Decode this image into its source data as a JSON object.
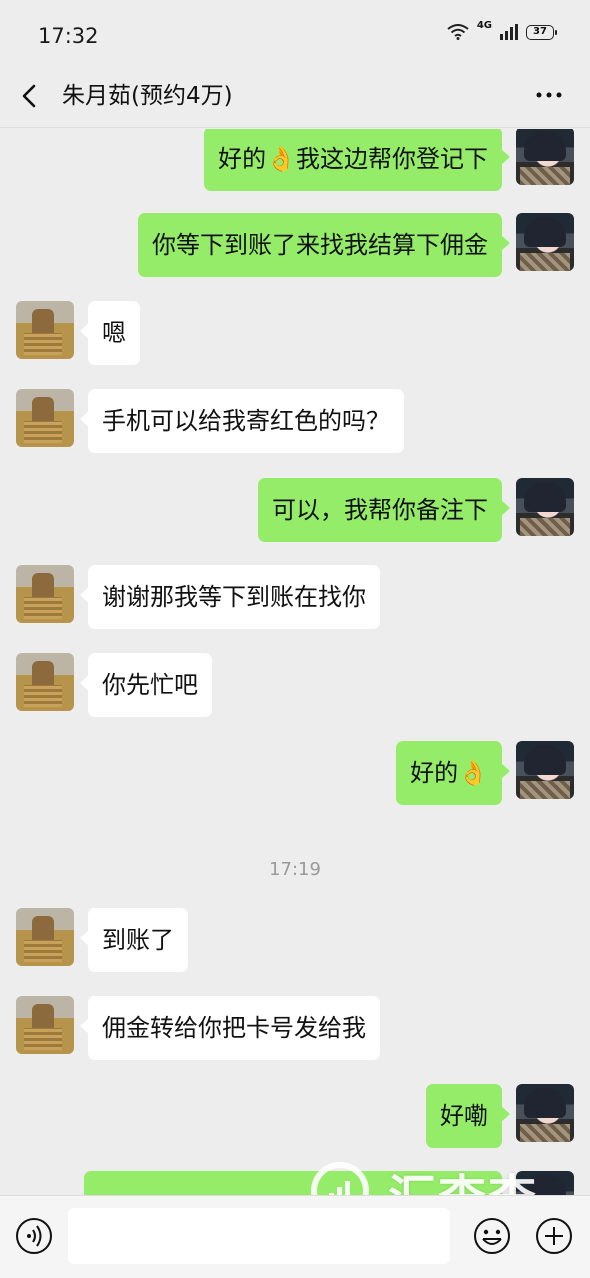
{
  "status_bar": {
    "time": "17:32",
    "network": "4G",
    "battery": "37"
  },
  "header": {
    "title": "朱月茹(预约4万)"
  },
  "messages": [
    {
      "from": "self",
      "text": "好的👌我这边帮你登记下"
    },
    {
      "from": "self",
      "text": "你等下到账了来找我结算下佣金"
    },
    {
      "from": "peer",
      "text": "嗯"
    },
    {
      "from": "peer",
      "text": "手机可以给我寄红色的吗？"
    },
    {
      "from": "self",
      "text": "可以，我帮你备注下"
    },
    {
      "from": "peer",
      "text": "谢谢那我等下到账在找你"
    },
    {
      "from": "peer",
      "text": "你先忙吧"
    },
    {
      "from": "self",
      "text": "好的👌"
    },
    {
      "from": "peer",
      "text": "到账了"
    },
    {
      "from": "peer",
      "text": "佣金转给你把卡号发给我"
    },
    {
      "from": "self",
      "text": "好嘞"
    },
    {
      "from": "self",
      "text": ""
    }
  ],
  "time_divider": "17:19",
  "watermark": {
    "text": "汇查查"
  },
  "input_bar": {
    "placeholder": ""
  },
  "colors": {
    "self_bubble": "#95ec69",
    "peer_bubble": "#ffffff",
    "background": "#ededed"
  }
}
